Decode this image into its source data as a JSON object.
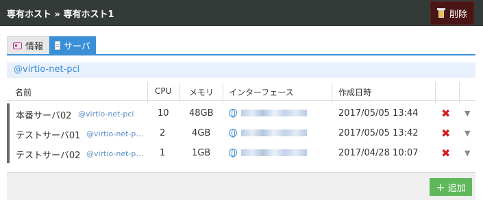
{
  "header": {
    "crumb1": "専有ホスト",
    "sep": "»",
    "crumb2": "専有ホスト1",
    "delete_label": "削除"
  },
  "tabs": {
    "info": "情報",
    "server": "サーバ"
  },
  "filter": "@virtio-net-pci",
  "table": {
    "columns": [
      "名前",
      "CPU",
      "メモリ",
      "インターフェース",
      "作成日時"
    ],
    "rows": [
      {
        "name": "本番サーバ02",
        "sub": "@virtio-net-pci",
        "cpu": "10",
        "mem": "48GB",
        "created": "2017/05/05 13:44"
      },
      {
        "name": "テストサーバ01",
        "sub": "@virtio-net-p…",
        "cpu": "2",
        "mem": "4GB",
        "created": "2017/05/05 13:42"
      },
      {
        "name": "テストサーバ02",
        "sub": "@virtio-net-p…",
        "cpu": "1",
        "mem": "1GB",
        "created": "2017/04/28 10:07"
      }
    ]
  },
  "footer": {
    "add_label": "追加"
  },
  "colors": {
    "accent": "#3a8fd6",
    "delete": "#d21f1f",
    "add": "#5fb85a"
  }
}
